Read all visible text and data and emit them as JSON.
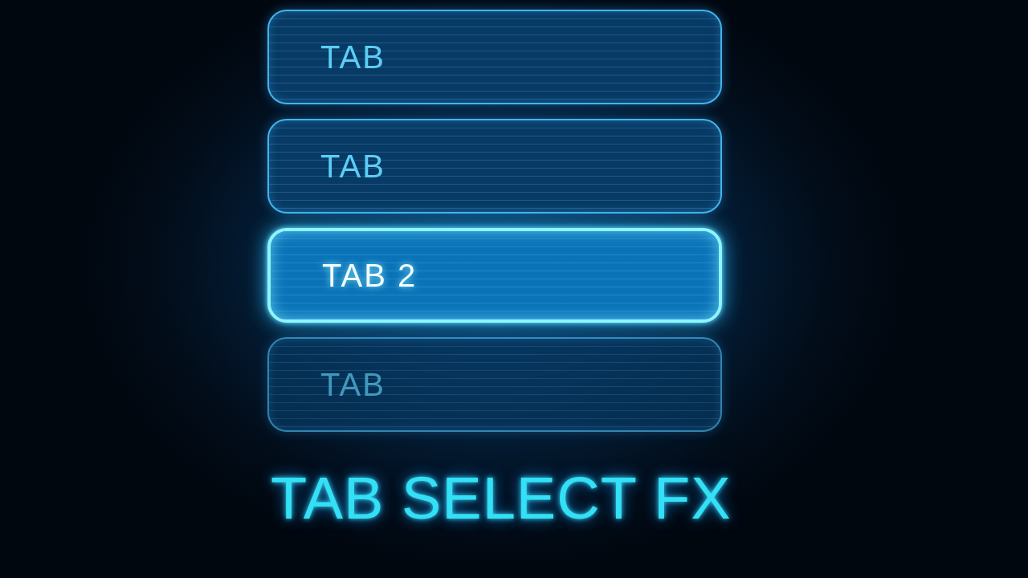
{
  "tabs": [
    {
      "label": "TAB",
      "selected": false
    },
    {
      "label": "TAB",
      "selected": false
    },
    {
      "label": "TAB 2",
      "selected": true
    },
    {
      "label": "TAB",
      "selected": false
    }
  ],
  "title": "TAB SELECT FX"
}
